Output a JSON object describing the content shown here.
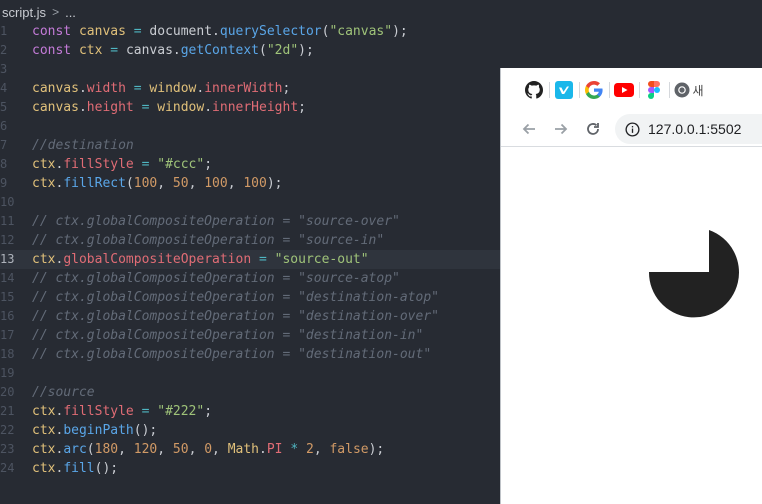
{
  "breadcrumb": {
    "file": "script.js",
    "separator": ">",
    "more": "..."
  },
  "editor": {
    "lines": [
      {
        "n": "1",
        "t": [
          [
            "kw",
            "const "
          ],
          [
            "id",
            "canvas"
          ],
          [
            "op",
            " = "
          ],
          [
            "pl",
            "document."
          ],
          [
            "fn",
            "querySelector"
          ],
          [
            "pl",
            "("
          ],
          [
            "st",
            "\"canvas\""
          ],
          [
            "pl",
            ");"
          ]
        ]
      },
      {
        "n": "2",
        "t": [
          [
            "kw",
            "const "
          ],
          [
            "id",
            "ctx"
          ],
          [
            "op",
            " = "
          ],
          [
            "pl",
            "canvas."
          ],
          [
            "fn",
            "getContext"
          ],
          [
            "pl",
            "("
          ],
          [
            "st",
            "\"2d\""
          ],
          [
            "pl",
            ");"
          ]
        ]
      },
      {
        "n": "3",
        "t": []
      },
      {
        "n": "4",
        "t": [
          [
            "id",
            "canvas"
          ],
          [
            "pl",
            "."
          ],
          [
            "pr",
            "width"
          ],
          [
            "op",
            " = "
          ],
          [
            "id",
            "window"
          ],
          [
            "pl",
            "."
          ],
          [
            "pr",
            "innerWidth"
          ],
          [
            "pl",
            ";"
          ]
        ]
      },
      {
        "n": "5",
        "t": [
          [
            "id",
            "canvas"
          ],
          [
            "pl",
            "."
          ],
          [
            "pr",
            "height"
          ],
          [
            "op",
            " = "
          ],
          [
            "id",
            "window"
          ],
          [
            "pl",
            "."
          ],
          [
            "pr",
            "innerHeight"
          ],
          [
            "pl",
            ";"
          ]
        ]
      },
      {
        "n": "6",
        "t": []
      },
      {
        "n": "7",
        "t": [
          [
            "cm",
            "//destination"
          ]
        ]
      },
      {
        "n": "8",
        "t": [
          [
            "id",
            "ctx"
          ],
          [
            "pl",
            "."
          ],
          [
            "pr",
            "fillStyle"
          ],
          [
            "op",
            " = "
          ],
          [
            "st",
            "\"#ccc\""
          ],
          [
            "pl",
            ";"
          ]
        ]
      },
      {
        "n": "9",
        "t": [
          [
            "id",
            "ctx"
          ],
          [
            "pl",
            "."
          ],
          [
            "fn",
            "fillRect"
          ],
          [
            "pl",
            "("
          ],
          [
            "nu",
            "100"
          ],
          [
            "pl",
            ", "
          ],
          [
            "nu",
            "50"
          ],
          [
            "pl",
            ", "
          ],
          [
            "nu",
            "100"
          ],
          [
            "pl",
            ", "
          ],
          [
            "nu",
            "100"
          ],
          [
            "pl",
            ");"
          ]
        ]
      },
      {
        "n": "10",
        "t": []
      },
      {
        "n": "11",
        "t": [
          [
            "cm",
            "// ctx.globalCompositeOperation = \"source-over\""
          ]
        ]
      },
      {
        "n": "12",
        "t": [
          [
            "cm",
            "// ctx.globalCompositeOperation = \"source-in\""
          ]
        ]
      },
      {
        "n": "13",
        "active": true,
        "t": [
          [
            "id",
            "ctx"
          ],
          [
            "pl",
            "."
          ],
          [
            "pr",
            "globalCompositeOperation"
          ],
          [
            "op",
            " = "
          ],
          [
            "st",
            "\"source-out\""
          ]
        ]
      },
      {
        "n": "14",
        "t": [
          [
            "cm",
            "// ctx.globalCompositeOperation = \"source-atop\""
          ]
        ]
      },
      {
        "n": "15",
        "t": [
          [
            "cm",
            "// ctx.globalCompositeOperation = \"destination-atop\""
          ]
        ]
      },
      {
        "n": "16",
        "t": [
          [
            "cm",
            "// ctx.globalCompositeOperation = \"destination-over\""
          ]
        ]
      },
      {
        "n": "17",
        "t": [
          [
            "cm",
            "// ctx.globalCompositeOperation = \"destination-in\""
          ]
        ]
      },
      {
        "n": "18",
        "t": [
          [
            "cm",
            "// ctx.globalCompositeOperation = \"destination-out\""
          ]
        ]
      },
      {
        "n": "19",
        "t": []
      },
      {
        "n": "20",
        "t": [
          [
            "cm",
            "//source"
          ]
        ]
      },
      {
        "n": "21",
        "t": [
          [
            "id",
            "ctx"
          ],
          [
            "pl",
            "."
          ],
          [
            "pr",
            "fillStyle"
          ],
          [
            "op",
            " = "
          ],
          [
            "st",
            "\"#222\""
          ],
          [
            "pl",
            ";"
          ]
        ]
      },
      {
        "n": "22",
        "t": [
          [
            "id",
            "ctx"
          ],
          [
            "pl",
            "."
          ],
          [
            "fn",
            "beginPath"
          ],
          [
            "pl",
            "();"
          ]
        ]
      },
      {
        "n": "23",
        "t": [
          [
            "id",
            "ctx"
          ],
          [
            "pl",
            "."
          ],
          [
            "fn",
            "arc"
          ],
          [
            "pl",
            "("
          ],
          [
            "nu",
            "180"
          ],
          [
            "pl",
            ", "
          ],
          [
            "nu",
            "120"
          ],
          [
            "pl",
            ", "
          ],
          [
            "nu",
            "50"
          ],
          [
            "pl",
            ", "
          ],
          [
            "nu",
            "0"
          ],
          [
            "pl",
            ", "
          ],
          [
            "id",
            "Math"
          ],
          [
            "pl",
            "."
          ],
          [
            "pr",
            "PI"
          ],
          [
            "op",
            " * "
          ],
          [
            "nu",
            "2"
          ],
          [
            "pl",
            ", "
          ],
          [
            "bo",
            "false"
          ],
          [
            "pl",
            ");"
          ]
        ]
      },
      {
        "n": "24",
        "t": [
          [
            "id",
            "ctx"
          ],
          [
            "pl",
            "."
          ],
          [
            "fn",
            "fill"
          ],
          [
            "pl",
            "();"
          ]
        ]
      }
    ]
  },
  "browser": {
    "bookmarks": [
      {
        "icon": "github-icon",
        "label": ""
      },
      {
        "icon": "vimeo-icon",
        "label": ""
      },
      {
        "icon": "google-icon",
        "label": ""
      },
      {
        "icon": "youtube-icon",
        "label": ""
      },
      {
        "icon": "figma-icon",
        "label": ""
      },
      {
        "icon": "chrome-icon",
        "label": "새"
      }
    ],
    "url": "127.0.0.1:5502",
    "shape_color": "#222222"
  }
}
